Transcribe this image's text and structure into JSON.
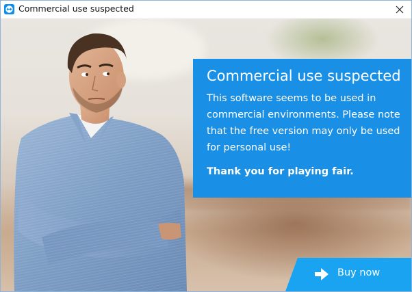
{
  "window": {
    "title": "Commercial use suspected",
    "app_icon": "teamviewer-icon",
    "close_icon": "close-icon"
  },
  "panel": {
    "heading": "Commercial use suspected",
    "body": "This software seems to be used in commercial environments. Please note that the free version may only be used for personal use!",
    "thanks": "Thank you for playing fair."
  },
  "buy": {
    "label": "Buy now",
    "icon": "arrow-right-icon"
  },
  "colors": {
    "accent": "#1a8fe6",
    "button": "#1aa3f0",
    "shirt": "#7f9fc4"
  }
}
